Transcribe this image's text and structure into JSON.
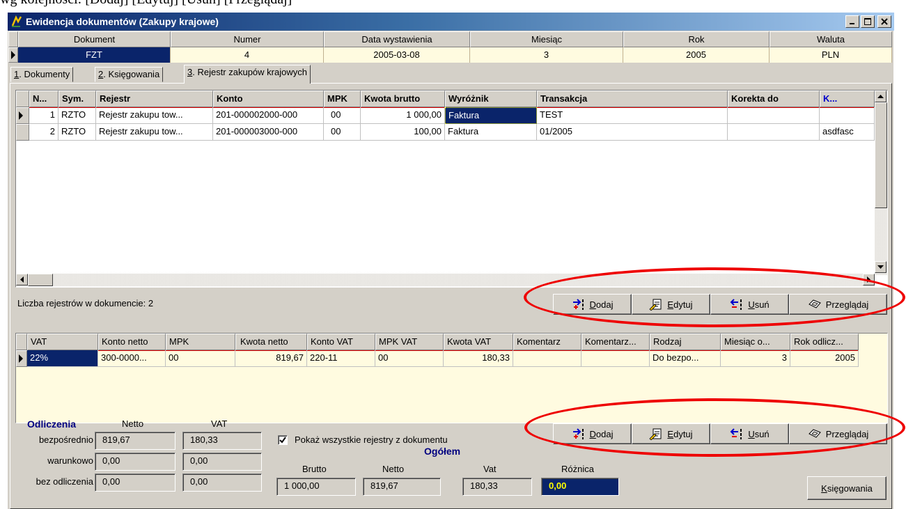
{
  "caption": "wg kolejności: [Dodaj] [Edytuj] [Usuń] [Przeglądaj]",
  "window": {
    "title": "Ewidencja dokumentów (Zakupy krajowe)"
  },
  "document_header": {
    "columns": [
      "Dokument",
      "Numer",
      "Data wystawienia",
      "Miesiąc",
      "Rok",
      "Waluta"
    ],
    "values": [
      "FZT",
      "4",
      "2005-03-08",
      "3",
      "2005",
      "PLN"
    ]
  },
  "tabs": [
    {
      "key": "1",
      "label": ". Dokumenty"
    },
    {
      "key": "2",
      "label": ". Księgowania"
    },
    {
      "key": "3",
      "label": ". Rejestr zakupów krajowych"
    }
  ],
  "registers_grid": {
    "columns": [
      "N...",
      "Sym.",
      "Rejestr",
      "Konto",
      "MPK",
      "Kwota brutto",
      "Wyróżnik",
      "Transakcja",
      "Korekta do",
      "K..."
    ],
    "rows": [
      [
        "1",
        "RZTO",
        "Rejestr zakupu tow...",
        "201-000002000-000",
        "00",
        "1 000,00",
        "Faktura",
        "TEST",
        "",
        ""
      ],
      [
        "2",
        "RZTO",
        "Rejestr zakupu tow...",
        "201-000003000-000",
        "00",
        "100,00",
        "Faktura",
        "01/2005",
        "",
        "asdfasc"
      ]
    ]
  },
  "register_count_label": "Liczba rejestrów w dokumencie: 2",
  "buttons": {
    "add": {
      "hotkey": "D",
      "rest": "odaj"
    },
    "edit": {
      "hotkey": "E",
      "rest": "dytuj"
    },
    "delete": {
      "hotkey": "U",
      "rest": "suń"
    },
    "browse": "Przeglądaj",
    "postings": {
      "hotkey": "K",
      "rest": "sięgowania"
    }
  },
  "vat_grid": {
    "columns": [
      "VAT",
      "Konto netto",
      "MPK",
      "Kwota netto",
      "Konto VAT",
      "MPK VAT",
      "Kwota VAT",
      "Komentarz",
      "Komentarz...",
      "Rodzaj",
      "Miesiąc o...",
      "Rok odlicz..."
    ],
    "rows": [
      [
        "22%",
        "300-0000...",
        "00",
        "819,67",
        "220-11",
        "00",
        "180,33",
        "",
        "",
        "Do bezpo...",
        "3",
        "2005"
      ]
    ]
  },
  "deductions": {
    "title": "Odliczenia",
    "netto_label": "Netto",
    "vat_label": "VAT",
    "rows": [
      {
        "label": "bezpośrednio",
        "netto": "819,67",
        "vat": "180,33"
      },
      {
        "label": "warunkowo",
        "netto": "0,00",
        "vat": "0,00"
      },
      {
        "label": "bez odliczenia",
        "netto": "0,00",
        "vat": "0,00"
      }
    ]
  },
  "show_all": {
    "label": "Pokaż wszystkie rejestry z dokumentu",
    "checked": true
  },
  "totals": {
    "title": "Ogółem",
    "brutto_label": "Brutto",
    "netto_label": "Netto",
    "vat_label": "Vat",
    "diff_label": "Różnica",
    "brutto": "1 000,00",
    "netto": "819,67",
    "vat": "180,33",
    "diff": "0,00"
  },
  "colors": {
    "highlight": "#ee0000",
    "selection": "#0a246a",
    "row_bg": "#fffbe0"
  }
}
